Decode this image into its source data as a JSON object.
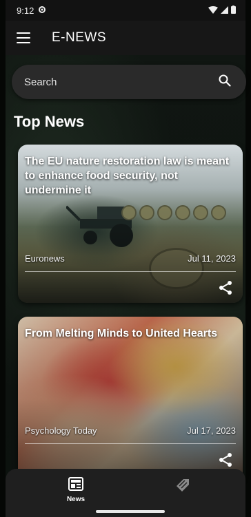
{
  "status_bar": {
    "time": "9:12"
  },
  "app_bar": {
    "title": "E-NEWS"
  },
  "search": {
    "placeholder": "Search"
  },
  "section": {
    "title": "Top News"
  },
  "articles": [
    {
      "title": "The EU nature restoration law is meant to enhance food security, not undermine it",
      "source": "Euronews",
      "date": "Jul 11, 2023"
    },
    {
      "title": "From Melting Minds to United Hearts",
      "source": "Psychology Today",
      "date": "Jul 17, 2023"
    }
  ],
  "bottom_nav": {
    "items": [
      {
        "label": "News",
        "icon": "newspaper-icon",
        "selected": true
      },
      {
        "label": "",
        "icon": "tag-icon",
        "selected": false
      }
    ]
  },
  "colors": {
    "app_bar": "#171717",
    "search_bg": "#2a2a2a",
    "bottom_nav": "#1f1f1f"
  }
}
